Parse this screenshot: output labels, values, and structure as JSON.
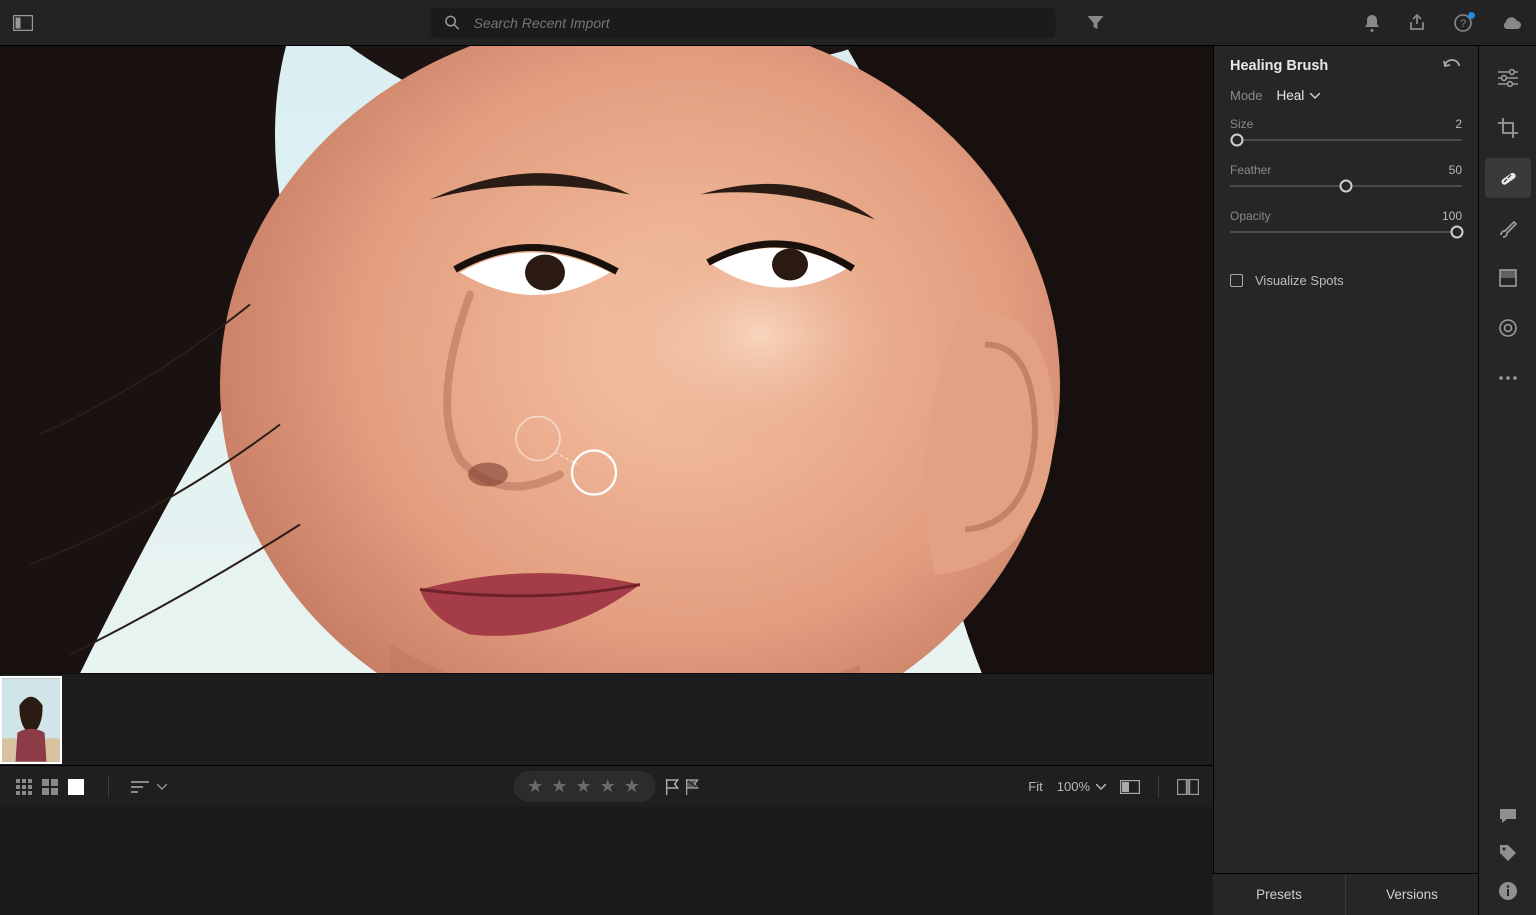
{
  "topbar": {
    "search_placeholder": "Search Recent Import"
  },
  "panel": {
    "title": "Healing Brush",
    "mode_label": "Mode",
    "mode_value": "Heal",
    "size_label": "Size",
    "size_value": "2",
    "feather_label": "Feather",
    "feather_value": "50",
    "opacity_label": "Opacity",
    "opacity_value": "100",
    "visualize_label": "Visualize Spots"
  },
  "rightTabs": {
    "presets": "Presets",
    "versions": "Versions"
  },
  "bottombar": {
    "fit_label": "Fit",
    "zoom_value": "100%"
  }
}
